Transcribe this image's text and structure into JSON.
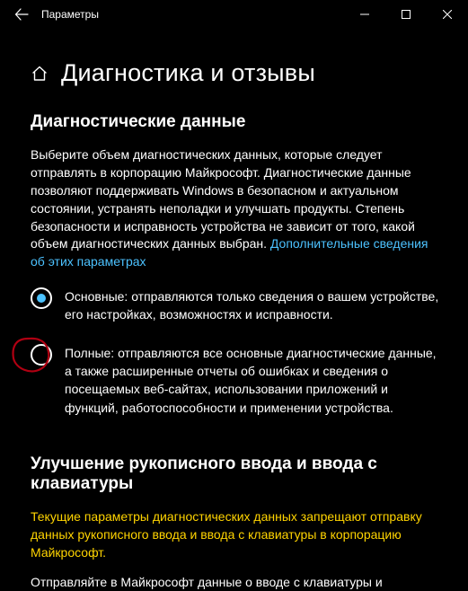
{
  "titlebar": {
    "title": "Параметры"
  },
  "header": {
    "page_title": "Диагностика и отзывы"
  },
  "diag": {
    "section_title": "Диагностические данные",
    "body_pre": "Выберите объем диагностических данных, которые следует отправлять в корпорацию Майкрософт. Диагностические данные позволяют поддерживать Windows в безопасном и актуальном состоянии, устранять неполадки и улучшать продукты. Степень безопасности и исправность устройства не зависит от того, какой объем диагностических данных выбран. ",
    "link": "Дополнительные сведения об этих параметрах",
    "radio_basic": "Основные: отправляются только сведения о вашем устройстве, его настройках, возможностях и исправности.",
    "radio_full": "Полные: отправляются все основные диагностические данные, а также расширенные отчеты об ошибках и сведения о посещаемых веб-сайтах, использовании приложений и функций, работоспособности и применении устройства."
  },
  "typing": {
    "section_title": "Улучшение рукописного ввода и ввода с клавиатуры",
    "warning": "Текущие параметры диагностических данных запрещают отправку данных рукописного ввода и ввода с клавиатуры в корпорацию Майкрософт.",
    "cutoff": "Отправляйте в Майкрософт данные о вводе с клавиатуры и"
  }
}
